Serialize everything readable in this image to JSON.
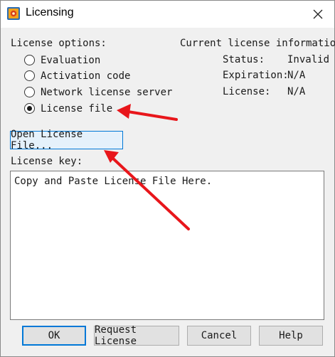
{
  "window": {
    "title": "Licensing",
    "icon": "app-icon",
    "close_icon": "close-icon"
  },
  "license_options": {
    "label": "License options:",
    "options": [
      {
        "label": "Evaluation",
        "selected": false
      },
      {
        "label": "Activation code",
        "selected": false
      },
      {
        "label": "Network license server",
        "selected": false
      },
      {
        "label": "License file",
        "selected": true
      }
    ]
  },
  "current_info": {
    "heading": "Current license information",
    "status_label": "Status:",
    "status_value": "Invalid",
    "expiration_label": "Expiration:",
    "expiration_value": "N/A",
    "license_label": "License:",
    "license_value": "N/A"
  },
  "open_button": "Open License File...",
  "license_key": {
    "label": "License key:",
    "value": "Copy and Paste License File Here."
  },
  "footer": {
    "ok": "OK",
    "request": "Request License",
    "cancel": "Cancel",
    "help": "Help"
  },
  "annotation_color": "#e8161b"
}
